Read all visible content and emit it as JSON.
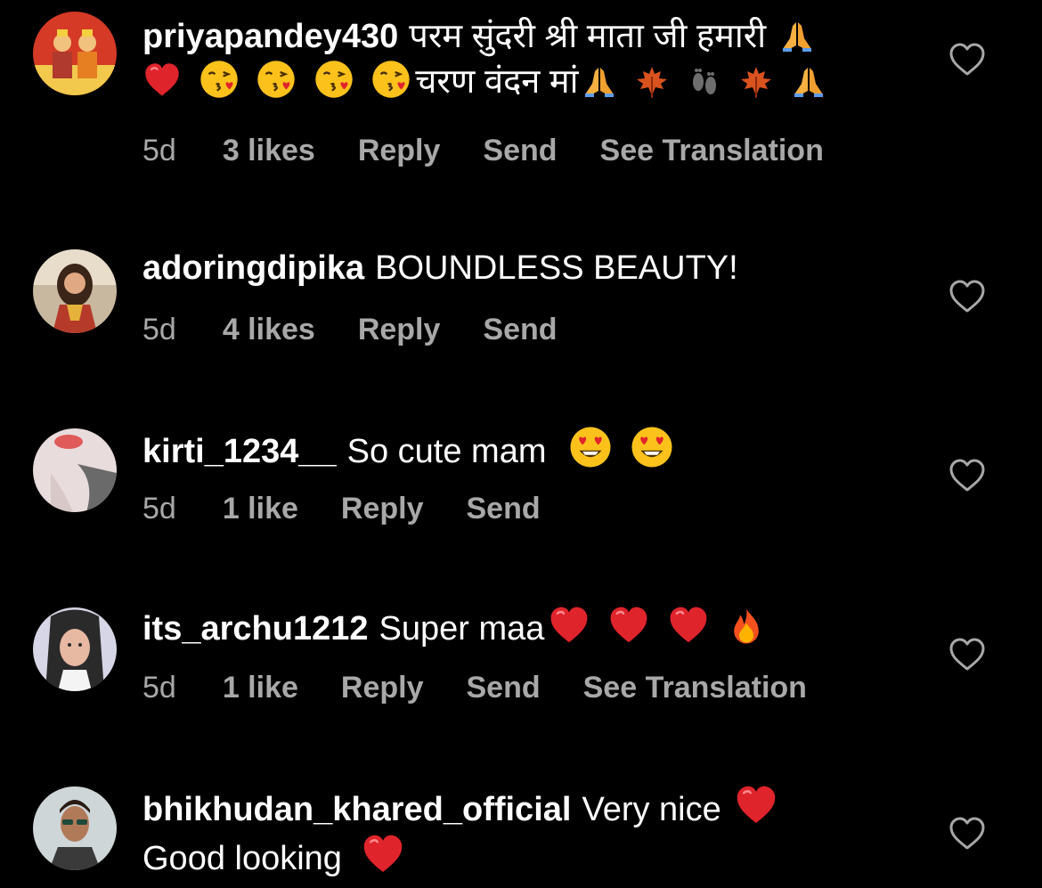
{
  "comments": [
    {
      "username": "priyapandey430",
      "text_part1": "परम सुंदरी श्री माता जी हमारी",
      "text_part2": "चरण वंदन मां",
      "time": "5d",
      "likes": "3 likes",
      "reply": "Reply",
      "send": "Send",
      "translate": "See Translation"
    },
    {
      "username": "adoringdipika",
      "text": "BOUNDLESS BEAUTY!",
      "time": "5d",
      "likes": "4 likes",
      "reply": "Reply",
      "send": "Send"
    },
    {
      "username": "kirti_1234__",
      "text": "So cute mam",
      "time": "5d",
      "likes": "1 like",
      "reply": "Reply",
      "send": "Send"
    },
    {
      "username": "its_archu1212",
      "text": "Super maa",
      "time": "5d",
      "likes": "1 like",
      "reply": "Reply",
      "send": "Send",
      "translate": "See Translation"
    },
    {
      "username": "bhikhudan_khared_official",
      "text_part1": "Very nice",
      "text_part2": "Good looking"
    }
  ],
  "icons": {
    "like": "heart-outline-icon",
    "red_heart": "red-heart-emoji",
    "kiss": "face-blowing-kiss-emoji",
    "pray": "folded-hands-emoji",
    "leaf": "maple-leaf-emoji",
    "feet": "footprints-emoji",
    "heart_eyes": "heart-eyes-emoji",
    "fire": "fire-emoji"
  },
  "colors": {
    "background": "#000000",
    "text": "#ffffff",
    "meta": "#a8a8a8",
    "red_heart": "#e0242b"
  }
}
